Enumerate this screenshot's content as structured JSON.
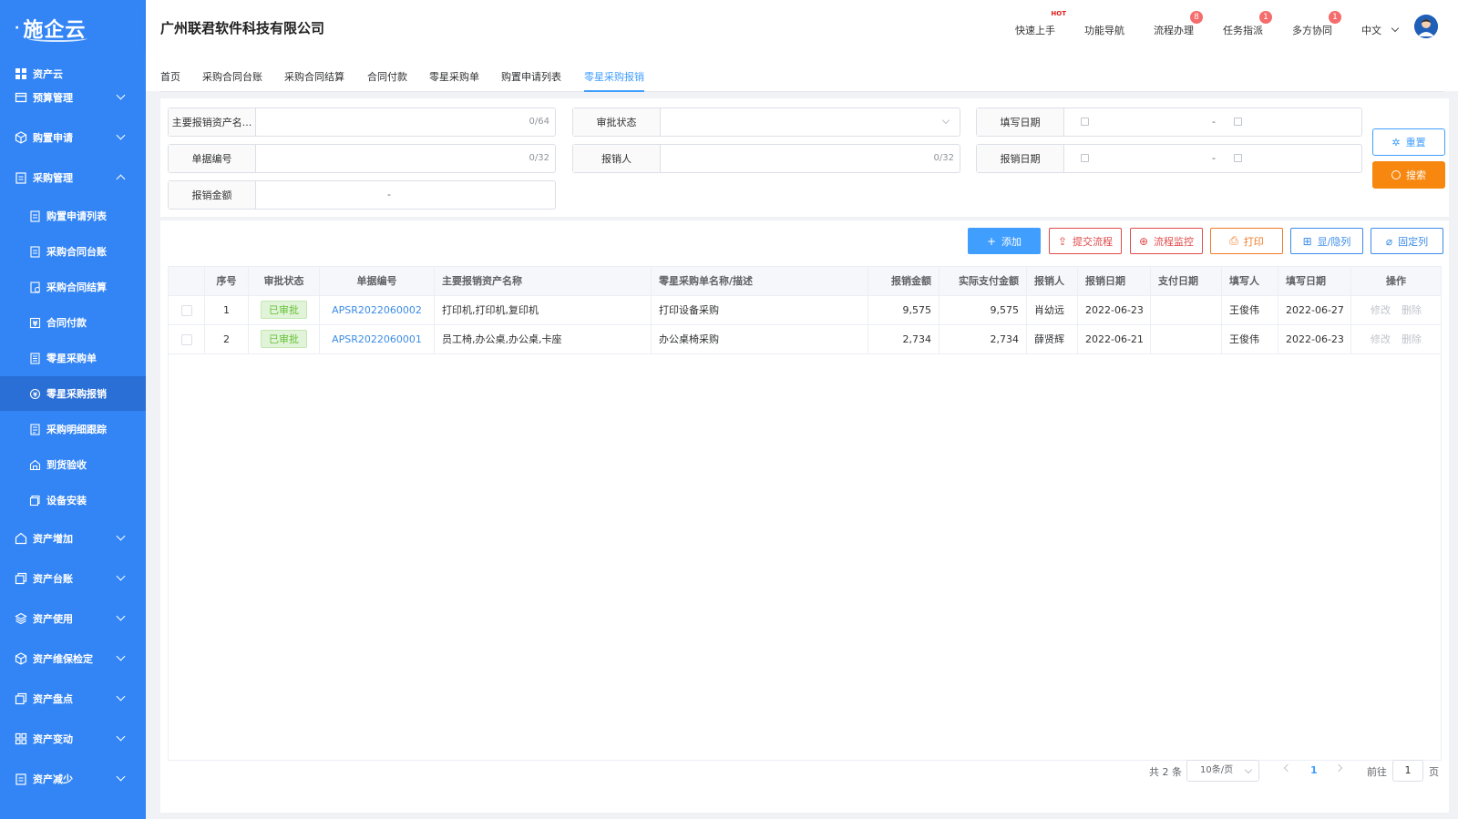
{
  "brand": {
    "logo_text": "施企云",
    "logo_dot": "·"
  },
  "sidebar": {
    "root": "资产云",
    "items": [
      {
        "label": "预算管理"
      },
      {
        "label": "购置申请"
      },
      {
        "label": "采购管理"
      },
      {
        "label": "资产增加"
      },
      {
        "label": "资产台账"
      },
      {
        "label": "资产使用"
      },
      {
        "label": "资产维保检定"
      },
      {
        "label": "资产盘点"
      },
      {
        "label": "资产变动"
      },
      {
        "label": "资产减少"
      }
    ],
    "sub_items": [
      {
        "label": "购置申请列表"
      },
      {
        "label": "采购合同台账"
      },
      {
        "label": "采购合同结算"
      },
      {
        "label": "合同付款"
      },
      {
        "label": "零星采购单"
      },
      {
        "label": "零星采购报销"
      },
      {
        "label": "采购明细跟踪"
      },
      {
        "label": "到货验收"
      },
      {
        "label": "设备安装"
      }
    ]
  },
  "header": {
    "company": "广州联君软件科技有限公司",
    "nav": [
      {
        "label": "快速上手",
        "hot": "HOT"
      },
      {
        "label": "功能导航"
      },
      {
        "label": "流程办理",
        "badge": "8"
      },
      {
        "label": "任务指派",
        "badge": "1"
      },
      {
        "label": "多方协同",
        "badge": "1"
      }
    ],
    "language": "中文"
  },
  "tabs": [
    "首页",
    "采购合同台账",
    "采购合同结算",
    "合同付款",
    "零星采购单",
    "购置申请列表",
    "零星采购报销"
  ],
  "filters": {
    "asset_name": {
      "label": "主要报销资产名...",
      "counter": "0/64"
    },
    "approval_status": {
      "label": "审批状态"
    },
    "fill_date": {
      "label": "填写日期",
      "sep": "-"
    },
    "doc_no": {
      "label": "单据编号",
      "counter": "0/32"
    },
    "reimburser": {
      "label": "报销人",
      "counter": "0/32"
    },
    "reimb_date": {
      "label": "报销日期",
      "sep": "-"
    },
    "amount": {
      "label": "报销金额",
      "sep": "-"
    },
    "reset": "重置",
    "search": "搜索"
  },
  "toolbar": {
    "add": "添加",
    "submit": "提交流程",
    "monitor": "流程监控",
    "print": "打印",
    "columns": "显/隐列",
    "pin": "固定列"
  },
  "table": {
    "headers": [
      "序号",
      "审批状态",
      "单据编号",
      "主要报销资产名称",
      "零星采购单名称/描述",
      "报销金额",
      "实际支付金额",
      "报销人",
      "报销日期",
      "支付日期",
      "填写人",
      "填写日期",
      "操作"
    ],
    "rows": [
      {
        "idx": "1",
        "status": "已审批",
        "doc_no": "APSR2022060002",
        "assets": "打印机,打印机,复印机",
        "desc": "打印设备采购",
        "amount": "9,575",
        "paid": "9,575",
        "person": "肖幼远",
        "date": "2022-06-23",
        "pay_date": "",
        "filler": "王俊伟",
        "fill_date": "2022-06-27",
        "edit": "修改",
        "del": "删除"
      },
      {
        "idx": "2",
        "status": "已审批",
        "doc_no": "APSR2022060001",
        "assets": "员工椅,办公桌,办公桌,卡座",
        "desc": "办公桌椅采购",
        "amount": "2,734",
        "paid": "2,734",
        "person": "薛贤辉",
        "date": "2022-06-21",
        "pay_date": "",
        "filler": "王俊伟",
        "fill_date": "2022-06-23",
        "edit": "修改",
        "del": "删除"
      }
    ]
  },
  "pagination": {
    "total": "共 2 条",
    "page_size": "10条/页",
    "current": "1",
    "goto_label": "前往",
    "goto_value": "1",
    "page_suffix": "页"
  },
  "colors": {
    "sidebar": "#3385f5",
    "primary": "#409eff",
    "search": "#f7870e",
    "danger": "#e04a4a"
  }
}
